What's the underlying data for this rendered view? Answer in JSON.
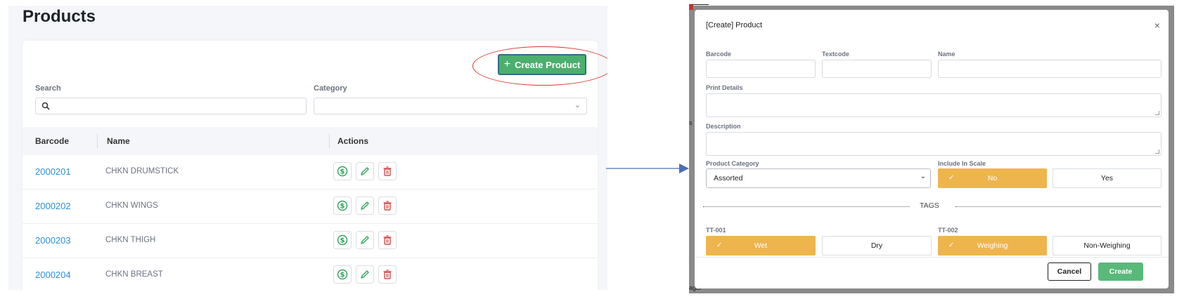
{
  "left_panel": {
    "page_title": "Products",
    "create_button_label": "Create Product",
    "search_label": "Search",
    "search_value": "",
    "category_label": "Category",
    "category_value": "",
    "table_headers": [
      "Barcode",
      "Name",
      "Actions"
    ],
    "rows": [
      {
        "barcode": "2000201",
        "name": "CHKN DRUMSTICK"
      },
      {
        "barcode": "2000202",
        "name": "CHKN WINGS"
      },
      {
        "barcode": "2000203",
        "name": "CHKN THIGH"
      },
      {
        "barcode": "2000204",
        "name": "CHKN BREAST"
      }
    ],
    "action_icons": [
      "dollar-icon",
      "pencil-icon",
      "trash-icon"
    ]
  },
  "dialog": {
    "title": "[Create] Product",
    "close_symbol": "×",
    "barcode_label": "Barcode",
    "textcode_label": "Textcode",
    "name_label": "Name",
    "print_details_label": "Print Details",
    "description_label": "Description",
    "product_category_label": "Product Category",
    "product_category_value": "Assorted",
    "include_in_scale_label": "Include In Scale",
    "include_in_scale_options": [
      "No",
      "Yes"
    ],
    "include_in_scale_selected": "No",
    "tags_title": "TAGS",
    "tag_groups": [
      {
        "label": "TT-001",
        "options": [
          "Wet",
          "Dry"
        ],
        "selected": "Wet"
      },
      {
        "label": "TT-002",
        "options": [
          "Weighing",
          "Non-Weighing"
        ],
        "selected": "Weighing"
      }
    ],
    "cancel_label": "Cancel",
    "create_label": "Create",
    "background_fragments": [
      "s",
      "ager"
    ]
  },
  "colors": {
    "primary_green": "#4caf6e",
    "link_blue": "#2d8fd5",
    "selected_toggle": "#eeb54d",
    "highlight_red": "#d9362b",
    "arrow_blue": "#4a6fb5"
  }
}
